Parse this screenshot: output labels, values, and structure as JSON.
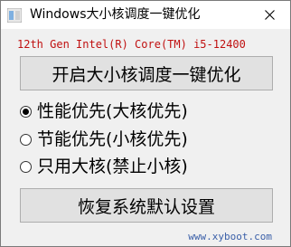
{
  "window": {
    "title": "Windows大小核调度一键优化",
    "close_symbol": "✕"
  },
  "cpu_info": "12th Gen Intel(R) Core(TM) i5-12400",
  "buttons": {
    "optimize": "开启大小核调度一键优化",
    "restore": "恢复系统默认设置"
  },
  "options": [
    {
      "label": "性能优先(大核优先)",
      "checked": true
    },
    {
      "label": "节能优先(小核优先)",
      "checked": false
    },
    {
      "label": "只用大核(禁止小核)",
      "checked": false
    }
  ],
  "watermark": "www.xyboot.com",
  "icons": {
    "app": "app-icon",
    "close": "close-icon"
  },
  "colors": {
    "cpu_text": "#c01010",
    "button_bg": "#e1e1e1",
    "window_bg": "#f0f0f0"
  }
}
